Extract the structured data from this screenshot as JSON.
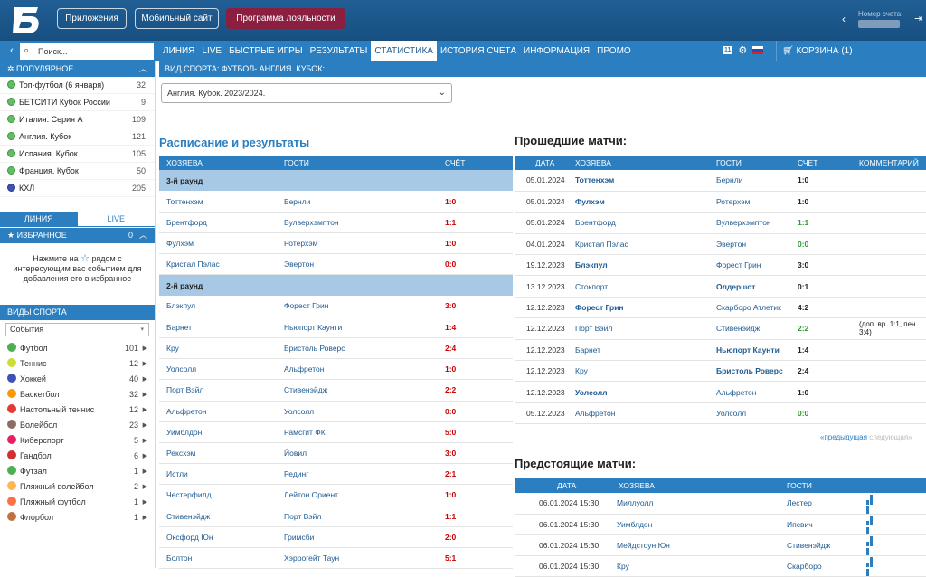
{
  "header": {
    "logo": "Б",
    "buttons": [
      "Приложения",
      "Мобильный сайт",
      "Программа лояльности"
    ],
    "account_label": "Номер счета:"
  },
  "nav": {
    "search_placeholder": "Поиск...",
    "menu": [
      "ЛИНИЯ",
      "LIVE",
      "БЫСТРЫЕ ИГРЫ",
      "РЕЗУЛЬТАТЫ",
      "СТАТИСТИКА",
      "ИСТОРИЯ СЧЕТА",
      "ИНФОРМАЦИЯ",
      "ПРОМО"
    ],
    "selected": "СТАТИСТИКА",
    "badge": "11",
    "cart": "КОРЗИНА (1)"
  },
  "sidebar": {
    "popular_title": "ПОПУЛЯРНОЕ",
    "popular": [
      {
        "label": "Топ-футбол (6 января)",
        "count": "32"
      },
      {
        "label": "БЕТСИТИ Кубок России",
        "count": "9"
      },
      {
        "label": "Италия. Серия А",
        "count": "109"
      },
      {
        "label": "Англия. Кубок",
        "count": "121"
      },
      {
        "label": "Испания. Кубок",
        "count": "105"
      },
      {
        "label": "Франция. Кубок",
        "count": "50"
      },
      {
        "label": "КХЛ",
        "count": "205"
      }
    ],
    "tab_line": "ЛИНИЯ",
    "tab_live": "LIVE",
    "fav_title": "ИЗБРАННОЕ",
    "fav_count": "0",
    "fav_text_1": "Нажмите на",
    "fav_text_2": "рядом с интересующим вас событием для добавления его в избранное",
    "sports_title": "ВИДЫ СПОРТА",
    "select_value": "События",
    "sports": [
      {
        "label": "Футбол",
        "count": "101",
        "color": "#4caf50"
      },
      {
        "label": "Теннис",
        "count": "12",
        "color": "#cddc39"
      },
      {
        "label": "Хоккей",
        "count": "40",
        "color": "#3f51b5"
      },
      {
        "label": "Баскетбол",
        "count": "32",
        "color": "#ff9800"
      },
      {
        "label": "Настольный теннис",
        "count": "12",
        "color": "#e53935"
      },
      {
        "label": "Волейбол",
        "count": "23",
        "color": "#8d6e63"
      },
      {
        "label": "Киберспорт",
        "count": "5",
        "color": "#e91e63"
      },
      {
        "label": "Гандбол",
        "count": "6",
        "color": "#d32f2f"
      },
      {
        "label": "Футзал",
        "count": "1",
        "color": "#4caf50"
      },
      {
        "label": "Пляжный волейбол",
        "count": "2",
        "color": "#ffb74d"
      },
      {
        "label": "Пляжный футбол",
        "count": "1",
        "color": "#ff7043"
      },
      {
        "label": "Флорбол",
        "count": "1",
        "color": "#bf7043"
      }
    ]
  },
  "main": {
    "sport_bar": "ВИД СПОРТА: ФУТБОЛ- АНГЛИЯ. КУБОК:",
    "tournament_select": "Англия. Кубок. 2023/2024.",
    "schedule_title": "Расписание и результаты",
    "schedule_headers": [
      "ХОЗЯЕВА",
      "ГОСТИ",
      "СЧЁТ"
    ],
    "schedule": [
      {
        "round": "3-й раунд"
      },
      {
        "home": "Тоттенхэм",
        "away": "Бернли",
        "score": "1:0"
      },
      {
        "home": "Брентфорд",
        "away": "Вулверхэмптон",
        "score": "1:1"
      },
      {
        "home": "Фулхэм",
        "away": "Ротерхэм",
        "score": "1:0"
      },
      {
        "home": "Кристал Пэлас",
        "away": "Эвертон",
        "score": "0:0"
      },
      {
        "round": "2-й раунд"
      },
      {
        "home": "Блэкпул",
        "away": "Форест Грин",
        "score": "3:0"
      },
      {
        "home": "Барнет",
        "away": "Ньюпорт Каунти",
        "score": "1:4"
      },
      {
        "home": "Кру",
        "away": "Бристоль Роверс",
        "score": "2:4"
      },
      {
        "home": "Уолсолл",
        "away": "Альфретон",
        "score": "1:0"
      },
      {
        "home": "Порт Вэйл",
        "away": "Стивенэйдж",
        "score": "2:2"
      },
      {
        "home": "Альфретон",
        "away": "Уолсолл",
        "score": "0:0"
      },
      {
        "home": "Уимблдон",
        "away": "Рамсгит ФК",
        "score": "5:0"
      },
      {
        "home": "Рексхэм",
        "away": "Йовил",
        "score": "3:0"
      },
      {
        "home": "Истли",
        "away": "Рединг",
        "score": "2:1"
      },
      {
        "home": "Честерфилд",
        "away": "Лейтон Ориент",
        "score": "1:0"
      },
      {
        "home": "Стивенэйдж",
        "away": "Порт Вэйл",
        "score": "1:1"
      },
      {
        "home": "Оксфорд Юн",
        "away": "Гримсби",
        "score": "2:0"
      },
      {
        "home": "Болтон",
        "away": "Хэррогейт Таун",
        "score": "5:1"
      }
    ],
    "past_title": "Прошедшие матчи:",
    "past_headers": [
      "ДАТА",
      "ХОЗЯЕВА",
      "ГОСТИ",
      "СЧЕТ",
      "КОММЕНТАРИЙ"
    ],
    "past": [
      {
        "date": "05.01.2024",
        "home": "Тоттенхэм",
        "away": "Бернли",
        "score": "1:0",
        "win": "home",
        "comment": ""
      },
      {
        "date": "05.01.2024",
        "home": "Фулхэм",
        "away": "Ротерхэм",
        "score": "1:0",
        "win": "home",
        "comment": ""
      },
      {
        "date": "05.01.2024",
        "home": "Брентфорд",
        "away": "Вулверхэмптон",
        "score": "1:1",
        "win": "draw",
        "comment": ""
      },
      {
        "date": "04.01.2024",
        "home": "Кристал Пэлас",
        "away": "Эвертон",
        "score": "0:0",
        "win": "draw",
        "comment": ""
      },
      {
        "date": "19.12.2023",
        "home": "Блэкпул",
        "away": "Форест Грин",
        "score": "3:0",
        "win": "home",
        "comment": ""
      },
      {
        "date": "13.12.2023",
        "home": "Стокпорт",
        "away": "Олдершот",
        "score": "0:1",
        "win": "away",
        "comment": ""
      },
      {
        "date": "12.12.2023",
        "home": "Форест Грин",
        "away": "Скарборо Атлетик",
        "score": "4:2",
        "win": "home",
        "comment": ""
      },
      {
        "date": "12.12.2023",
        "home": "Порт Вэйл",
        "away": "Стивенэйдж",
        "score": "2:2",
        "win": "draw",
        "comment": "(доп. вр. 1:1, пен. 3:4)"
      },
      {
        "date": "12.12.2023",
        "home": "Барнет",
        "away": "Ньюпорт Каунти",
        "score": "1:4",
        "win": "away",
        "comment": ""
      },
      {
        "date": "12.12.2023",
        "home": "Кру",
        "away": "Бристоль Роверс",
        "score": "2:4",
        "win": "away",
        "comment": ""
      },
      {
        "date": "12.12.2023",
        "home": "Уолсолл",
        "away": "Альфретон",
        "score": "1:0",
        "win": "home",
        "comment": ""
      },
      {
        "date": "05.12.2023",
        "home": "Альфретон",
        "away": "Уолсолл",
        "score": "0:0",
        "win": "draw",
        "comment": ""
      }
    ],
    "pager_prev": "«предыдущая",
    "pager_next": "следующая»",
    "upcoming_title": "Предстоящие матчи:",
    "upcoming_headers": [
      "ДАТА",
      "ХОЗЯЕВА",
      "ГОСТИ"
    ],
    "upcoming": [
      {
        "date": "06.01.2024 15:30",
        "home": "Миллуолл",
        "away": "Лестер"
      },
      {
        "date": "06.01.2024 15:30",
        "home": "Уимблдон",
        "away": "Ипсвич"
      },
      {
        "date": "06.01.2024 15:30",
        "home": "Мейдстоун Юн",
        "away": "Стивенэйдж"
      },
      {
        "date": "06.01.2024 15:30",
        "home": "Кру",
        "away": "Скарборо"
      }
    ]
  }
}
